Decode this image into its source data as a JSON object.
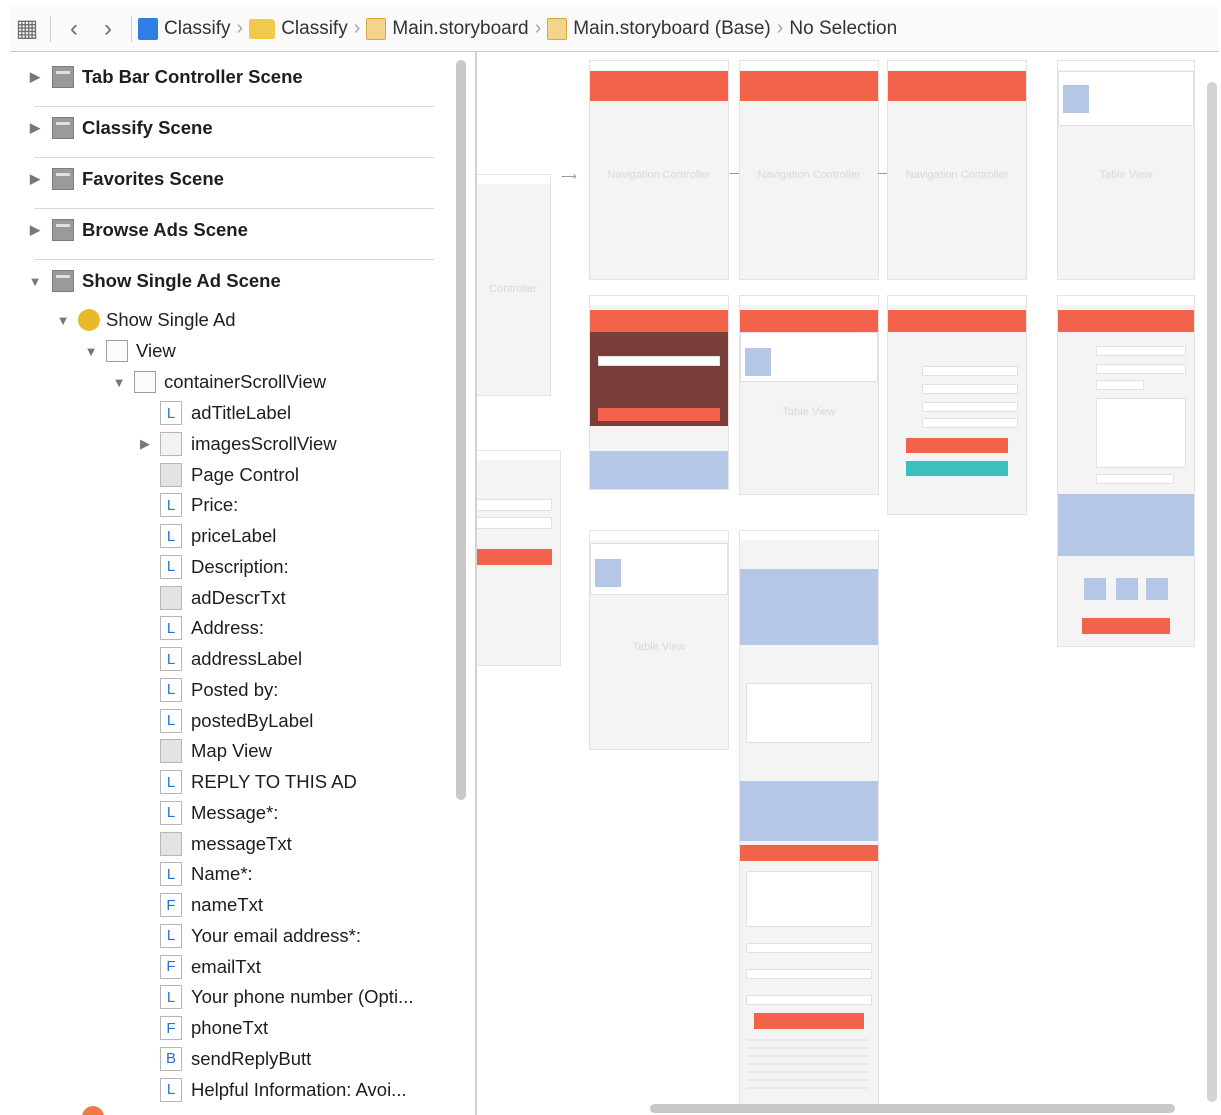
{
  "jumpbar": {
    "crumbs": [
      "Classify",
      "Classify",
      "Main.storyboard",
      "Main.storyboard (Base)",
      "No Selection"
    ]
  },
  "outline": {
    "scenes": [
      "Tab Bar Controller Scene",
      "Classify Scene",
      "Favorites Scene",
      "Browse Ads Scene",
      "Show Single Ad Scene"
    ],
    "view_controller": "Show Single Ad",
    "view": "View",
    "container": "containerScrollView",
    "items": [
      {
        "label": "adTitleLabel",
        "icon": "L"
      },
      {
        "label": "imagesScrollView",
        "icon": "view"
      },
      {
        "label": "Page Control",
        "icon": "gray"
      },
      {
        "label": "Price:",
        "icon": "L"
      },
      {
        "label": "priceLabel",
        "icon": "L"
      },
      {
        "label": "Description:",
        "icon": "L"
      },
      {
        "label": "adDescrTxt",
        "icon": "gray"
      },
      {
        "label": "Address:",
        "icon": "L"
      },
      {
        "label": "addressLabel",
        "icon": "L"
      },
      {
        "label": "Posted by:",
        "icon": "L"
      },
      {
        "label": "postedByLabel",
        "icon": "L"
      },
      {
        "label": "Map View",
        "icon": "gray"
      },
      {
        "label": "REPLY TO THIS AD",
        "icon": "L"
      },
      {
        "label": "Message*:",
        "icon": "L"
      },
      {
        "label": "messageTxt",
        "icon": "gray"
      },
      {
        "label": "Name*:",
        "icon": "L"
      },
      {
        "label": "nameTxt",
        "icon": "F"
      },
      {
        "label": "Your email address*:",
        "icon": "L"
      },
      {
        "label": "emailTxt",
        "icon": "F"
      },
      {
        "label": "Your phone number (Opti...",
        "icon": "L"
      },
      {
        "label": "phoneTxt",
        "icon": "F"
      },
      {
        "label": "sendReplyButt",
        "icon": "B"
      },
      {
        "label": "Helpful Information: Avoi...",
        "icon": "L"
      }
    ]
  },
  "canvas": {
    "nav_label": "Navigation Controller",
    "controller_label": "Controller",
    "table_label": "Table View"
  },
  "colors": {
    "accent_red": "#f3624a",
    "placeholder_blue": "#b4c7e7",
    "teal": "#3cbfbf"
  }
}
